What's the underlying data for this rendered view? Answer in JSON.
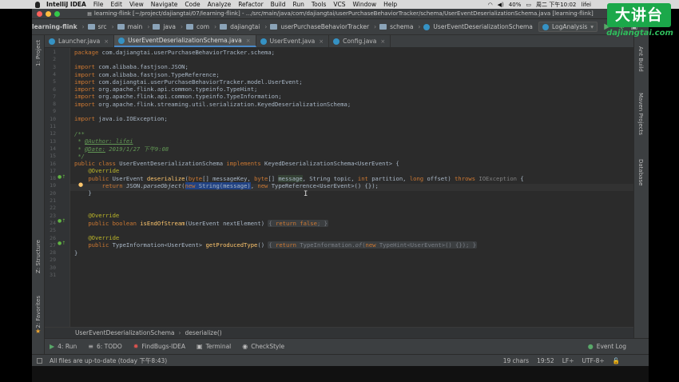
{
  "menubar": {
    "app_name": "IntelliJ IDEA",
    "items": [
      "File",
      "Edit",
      "View",
      "Navigate",
      "Code",
      "Analyze",
      "Refactor",
      "Build",
      "Run",
      "Tools",
      "VCS",
      "Window",
      "Help"
    ],
    "battery": "40%",
    "clock": "周二 下午10:02",
    "user": "lifei"
  },
  "window": {
    "title": "learning-flink [~/project/dajiangtai/07/learning-flink] - .../src/main/java/com/dajiangtai/userPurchaseBehaviorTracker/schema/UserEventDeserializationSchema.java [learning-flink]"
  },
  "navbar": {
    "crumbs": [
      "learning-flink",
      "src",
      "main",
      "java",
      "com",
      "dajiangtai",
      "userPurchaseBehaviorTracker",
      "schema",
      "UserEventDeserializationSchema"
    ],
    "run_config": "LogAnalysis"
  },
  "left_stripe": {
    "project": "1: Project",
    "structure": "Z: Structure",
    "favorites": "2: Favorites"
  },
  "right_stripe": {
    "ant": "Ant Build",
    "maven": "Maven Projects",
    "database": "Database"
  },
  "tabs": [
    {
      "label": "Launcher.java",
      "active": false
    },
    {
      "label": "UserEventDeserializationSchema.java",
      "active": true
    },
    {
      "label": "UserEvent.java",
      "active": false
    },
    {
      "label": "Config.java",
      "active": false
    }
  ],
  "editor": {
    "line_numbers": [
      "1",
      "2",
      "3",
      "4",
      "5",
      "6",
      "7",
      "8",
      "9",
      "10",
      "11",
      "12",
      "13",
      "14",
      "15",
      "16",
      "17",
      "18",
      "19",
      "20",
      "21",
      "22",
      "23",
      "24",
      "25",
      "26",
      "27",
      "28",
      "29",
      "30",
      "31"
    ],
    "code": {
      "l1_kw": "package",
      "l1_rest": " com.dajiangtai.userPurchaseBehaviorTracker.schema;",
      "import_kw": "import",
      "l3": " com.alibaba.fastjson.JSON;",
      "l4": " com.alibaba.fastjson.TypeReference;",
      "l5": " com.dajiangtai.userPurchaseBehaviorTracker.model.UserEvent;",
      "l6": " org.apache.flink.api.common.typeinfo.TypeHint;",
      "l7": " org.apache.flink.api.common.typeinfo.TypeInformation;",
      "l8": " org.apache.flink.streaming.util.serialization.KeyedDeserializationSchema;",
      "l10": " java.io.IOException;",
      "l12": "/**",
      "l13_star": " * ",
      "l13_tag": "@Author:",
      "l13_val": " lifei",
      "l14_star": " * ",
      "l14_tag": "@Date:",
      "l14_val": " 2019/1/27 下午9:08",
      "l15": " */",
      "l16_kw1": "public class",
      "l16_name": " UserEventDeserializationSchema ",
      "l16_kw2": "implements",
      "l16_rest": " KeyedDeserializationSchema<UserEvent> {",
      "override": "@Override",
      "l18_kw1": "public",
      "l18_type": " UserEvent ",
      "l18_fn": "deserialize",
      "l18_a": "(",
      "l18_byte1": "byte",
      "l18_b": "[] messageKey, ",
      "l18_byte2": "byte",
      "l18_c": "[] ",
      "l18_msg": "message",
      "l18_d": ", String topic, ",
      "l18_int": "int",
      "l18_e": " partition, ",
      "l18_long": "long",
      "l18_f": " offset) ",
      "l18_throws": "throws",
      "l18_g": " ",
      "l18_exc": "IOException",
      "l18_h": " {",
      "l19_return": "return",
      "l19_a": " JSON.",
      "l19_parse": "parseObject",
      "l19_b": "(",
      "l19_new": "new",
      "l19_c": " String(message)",
      "l19_d": ", ",
      "l19_new2": "new",
      "l19_e": " TypeReference<UserEvent>() {});",
      "close_brace": "}",
      "l23_kw": "public boolean",
      "l23_fn": " isEndOfStream",
      "l23_a": "(UserEvent nextElement) ",
      "l23_fold_open": "{",
      "l23_return": " return",
      "l23_false": " false",
      "l23_b": "; ",
      "l23_fold_close": "}",
      "l28_kw": "public",
      "l28_a": " TypeInformation<UserEvent> ",
      "l28_fn": "getProducedType",
      "l28_b": "() ",
      "l28_fold_open": "{",
      "l28_return": " return",
      "l28_c": " TypeInformation.",
      "l28_of": "of",
      "l28_d": "(",
      "l28_new": "new",
      "l28_e": " TypeHint<UserEvent>() {}); ",
      "l28_fold_close": "}",
      "l30": "}"
    }
  },
  "editor_crumb": {
    "class_name": "UserEventDeserializationSchema",
    "method_name": "deserialize()"
  },
  "toolwindows": {
    "run": "4: Run",
    "todo": "6: TODO",
    "findbugs": "FindBugs-IDEA",
    "terminal": "Terminal",
    "checkstyle": "CheckStyle",
    "event_log": "Event Log"
  },
  "statusbar": {
    "message": "All files are up-to-date (today 下午8:43)",
    "chars": "19 chars",
    "position": "19:52",
    "line_sep": "LF÷",
    "encoding": "UTF-8÷"
  },
  "watermark": {
    "logo": "大讲台",
    "url": "dajiangtai.com"
  },
  "colors": {
    "editor_bg": "#2b2b2b",
    "keyword": "#cc7832",
    "annotation": "#bbb529",
    "method": "#ffc66d",
    "doc_comment": "#629755",
    "watermark_green": "#1ba84a"
  }
}
